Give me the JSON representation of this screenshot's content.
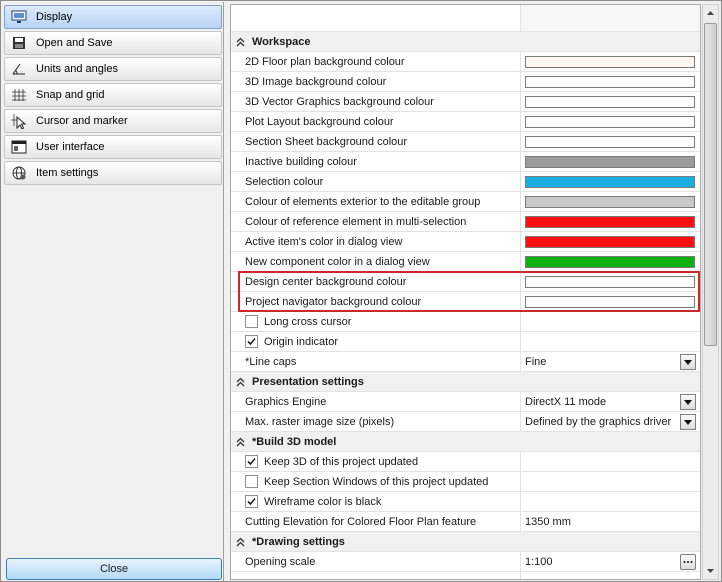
{
  "nav": {
    "items": [
      {
        "label": "Display",
        "icon": "monitor-icon",
        "active": true
      },
      {
        "label": "Open and Save",
        "icon": "floppy-icon",
        "active": false
      },
      {
        "label": "Units and angles",
        "icon": "angle-icon",
        "active": false
      },
      {
        "label": "Snap and grid",
        "icon": "grid-icon",
        "active": false
      },
      {
        "label": "Cursor and marker",
        "icon": "cursor-icon",
        "active": false
      },
      {
        "label": "User interface",
        "icon": "window-icon",
        "active": false
      },
      {
        "label": "Item settings",
        "icon": "globe-gear-icon",
        "active": false
      }
    ],
    "close_label": "Close"
  },
  "grid": {
    "workspace": {
      "title": "Workspace",
      "rows": [
        {
          "label": "2D Floor plan background colour",
          "color": "#fdf6ec"
        },
        {
          "label": "3D Image background colour",
          "color": "#ffffff"
        },
        {
          "label": "3D Vector Graphics background colour",
          "color": "#ffffff"
        },
        {
          "label": "Plot Layout background colour",
          "color": "#ffffff"
        },
        {
          "label": "Section Sheet background colour",
          "color": "#ffffff"
        },
        {
          "label": "Inactive building colour",
          "color": "#9c9c9c"
        },
        {
          "label": "Selection colour",
          "color": "#1aaee0"
        },
        {
          "label": "Colour of elements exterior to the editable group",
          "color": "#c8c8c8"
        },
        {
          "label": "Colour of reference element in multi-selection",
          "color": "#ff1010"
        },
        {
          "label": "Active item's color in dialog view",
          "color": "#ff1010"
        },
        {
          "label": "New component color in a dialog view",
          "color": "#10b010"
        },
        {
          "label": "Design center background colour",
          "color": "#ffffff"
        },
        {
          "label": "Project navigator background colour",
          "color": "#ffffff"
        }
      ],
      "long_cross_cursor": {
        "label": "Long cross cursor",
        "checked": false
      },
      "origin_indicator": {
        "label": "Origin indicator",
        "checked": true
      },
      "line_caps": {
        "label": "*Line caps",
        "value": "Fine"
      }
    },
    "presentation": {
      "title": "Presentation settings",
      "graphics_engine": {
        "label": "Graphics Engine",
        "value": "DirectX 11 mode"
      },
      "max_raster": {
        "label": "Max. raster image size (pixels)",
        "value": "Defined by the graphics driver"
      }
    },
    "build3d": {
      "title": "*Build 3D model",
      "keep_3d": {
        "label": "Keep 3D of this project updated",
        "checked": true
      },
      "keep_section": {
        "label": "Keep Section Windows of this project updated",
        "checked": false
      },
      "wireframe": {
        "label": "Wireframe color is black",
        "checked": true
      },
      "cutting_elevation": {
        "label": "Cutting Elevation for Colored Floor Plan feature",
        "value": "1350 mm"
      }
    },
    "drawing": {
      "title": "*Drawing settings",
      "opening_scale": {
        "label": "Opening scale",
        "value": "1:100"
      }
    }
  }
}
